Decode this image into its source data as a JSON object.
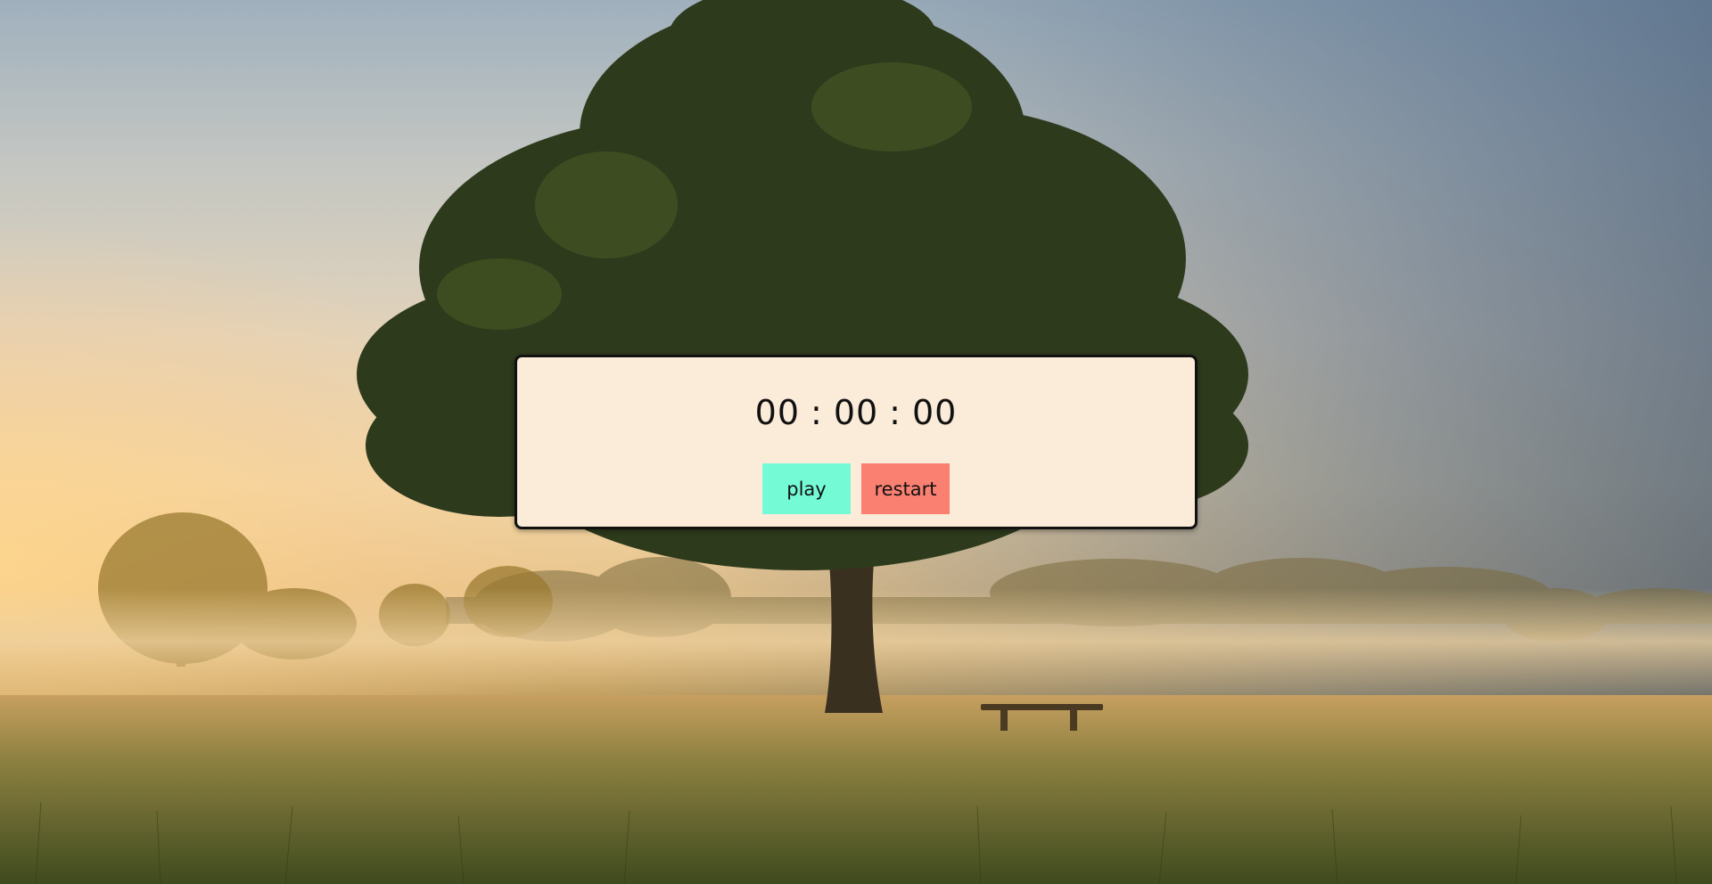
{
  "timer": {
    "hours": "00",
    "minutes": "00",
    "seconds": "00",
    "separator": ":"
  },
  "controls": {
    "play_label": "play",
    "restart_label": "restart"
  },
  "colors": {
    "panel_background": "#fbecd9",
    "panel_border": "#111111",
    "play_button": "#74fbd6",
    "restart_button": "#fa8072"
  }
}
